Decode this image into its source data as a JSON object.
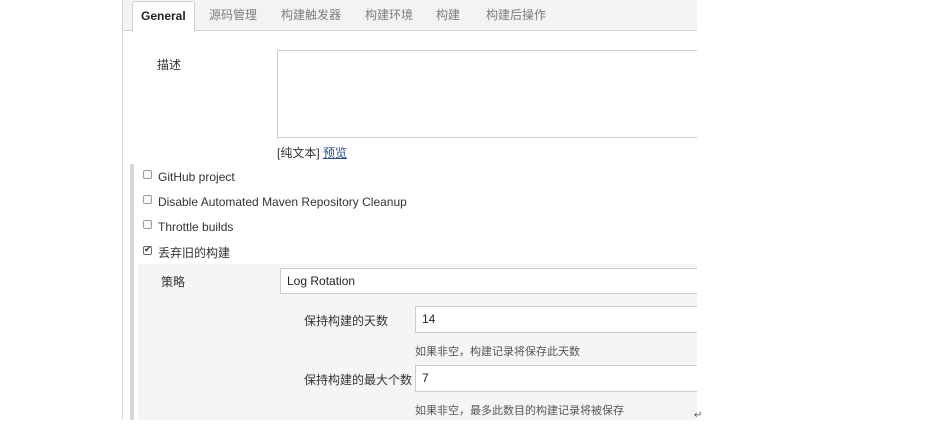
{
  "tabs": [
    {
      "label": "General",
      "active": true
    },
    {
      "label": "源码管理"
    },
    {
      "label": "构建触发器"
    },
    {
      "label": "构建环境"
    },
    {
      "label": "构建"
    },
    {
      "label": "构建后操作"
    }
  ],
  "description": {
    "label": "描述",
    "value": "",
    "format_text": "[纯文本]",
    "preview_link": "预览"
  },
  "options": [
    {
      "label": "GitHub project",
      "checked": false
    },
    {
      "label": "Disable Automated Maven Repository Cleanup",
      "checked": false
    },
    {
      "label": "Throttle builds",
      "checked": false
    },
    {
      "label": "丢弃旧的构建",
      "checked": true
    }
  ],
  "discard": {
    "strategy_label": "策略",
    "strategy_value": "Log Rotation",
    "days_label": "保持构建的天数",
    "days_value": "14",
    "days_help": "如果非空，构建记录将保存此天数",
    "max_label": "保持构建的最大个数",
    "max_value": "7",
    "max_help": "如果非空，最多此数目的构建记录将被保存"
  },
  "pilcrow": "↵"
}
